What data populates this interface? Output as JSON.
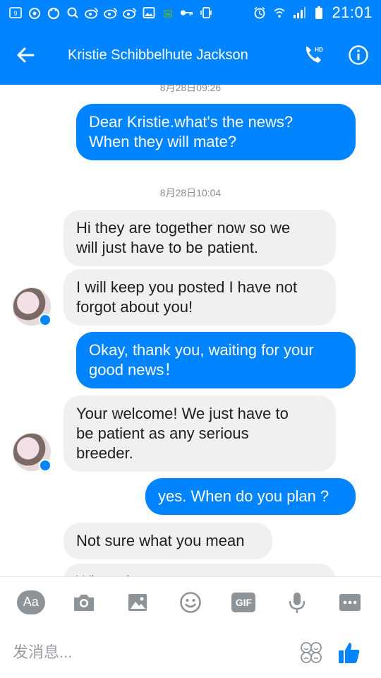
{
  "status_bar": {
    "time": "21:01",
    "left_icons": [
      "notification-9-icon",
      "weibo-icon",
      "circle-app-icon",
      "search-app-icon",
      "weibo-icon",
      "weibo-icon",
      "weibo-icon",
      "image-icon",
      "battery-small-icon",
      "key-icon",
      "vibrate-icon"
    ],
    "right_icons": [
      "alarm-icon",
      "wifi-icon",
      "signal-icon",
      "battery-icon"
    ]
  },
  "header": {
    "title": "Kristie Schibbelhute Jackson",
    "hd_label": "HD"
  },
  "chat": {
    "messages": [
      {
        "type": "timestamp",
        "text": "8月28日09:26"
      },
      {
        "type": "out",
        "text": "Dear Kristie.what's the news?\nWhen they will mate?"
      },
      {
        "type": "timestamp",
        "text": "8月28日10:04"
      },
      {
        "type": "in",
        "text": "Hi they are together now so we\nwill just have to be patient."
      },
      {
        "type": "in",
        "text": "I will keep you posted I have not\nforgot about you!"
      },
      {
        "type": "out",
        "text": "Okay, thank you, waiting for your\ngood news！"
      },
      {
        "type": "in",
        "text": "Your welcome! We just have to\nbe patient as any serious\nbreeder."
      },
      {
        "type": "out",
        "text": "yes. When do you plan ?"
      },
      {
        "type": "in",
        "text": "Not sure what you mean"
      },
      {
        "type": "in",
        "text": "When do you to ..."
      }
    ]
  },
  "toolbar": {
    "aa_label": "Aa",
    "gif_label": "GIF"
  },
  "composer": {
    "placeholder": "发消息..."
  },
  "colors": {
    "accent": "#0084ff",
    "incoming_bubble": "#f1f0f0",
    "icon_gray": "#8e9398"
  }
}
